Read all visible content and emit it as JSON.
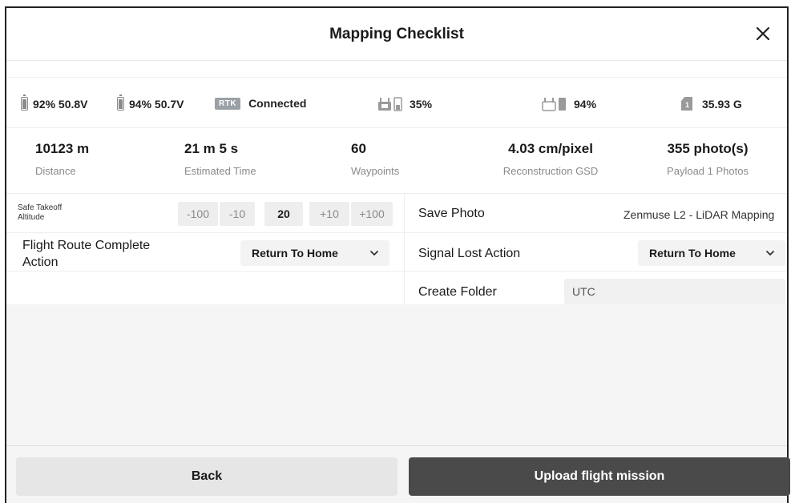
{
  "header": {
    "title": "Mapping Checklist"
  },
  "status": {
    "battery1": "92% 50.8V",
    "battery2": "94% 50.7V",
    "rtk_badge": "RTK",
    "rtk_status": "Connected",
    "rc_signal": "35%",
    "video_signal": "94%",
    "storage_badge": "1",
    "storage": "35.93 G"
  },
  "stats": [
    {
      "value": "10123 m",
      "label": "Distance"
    },
    {
      "value": "21 m 5 s",
      "label": "Estimated Time"
    },
    {
      "value": "60",
      "label": "Waypoints"
    },
    {
      "value": "4.03 cm/pixel",
      "label": "Reconstruction GSD"
    },
    {
      "value": "355 photo(s)",
      "label": "Payload 1 Photos"
    }
  ],
  "settings": {
    "altitude_label": "Safe Takeoff Altitude",
    "altitude_steps": [
      "-100",
      "-10",
      "+10",
      "+100"
    ],
    "altitude_value": "20",
    "save_photo_label": "Save Photo",
    "save_photo_value": "Zenmuse L2 - LiDAR Mapping",
    "route_complete_label": "Flight Route Complete Action",
    "route_complete_value": "Return To Home",
    "signal_lost_label": "Signal Lost Action",
    "signal_lost_value": "Return To Home",
    "create_folder_label": "Create Folder",
    "create_folder_value": "UTC"
  },
  "footer": {
    "back_label": "Back",
    "upload_label": "Upload flight mission"
  }
}
